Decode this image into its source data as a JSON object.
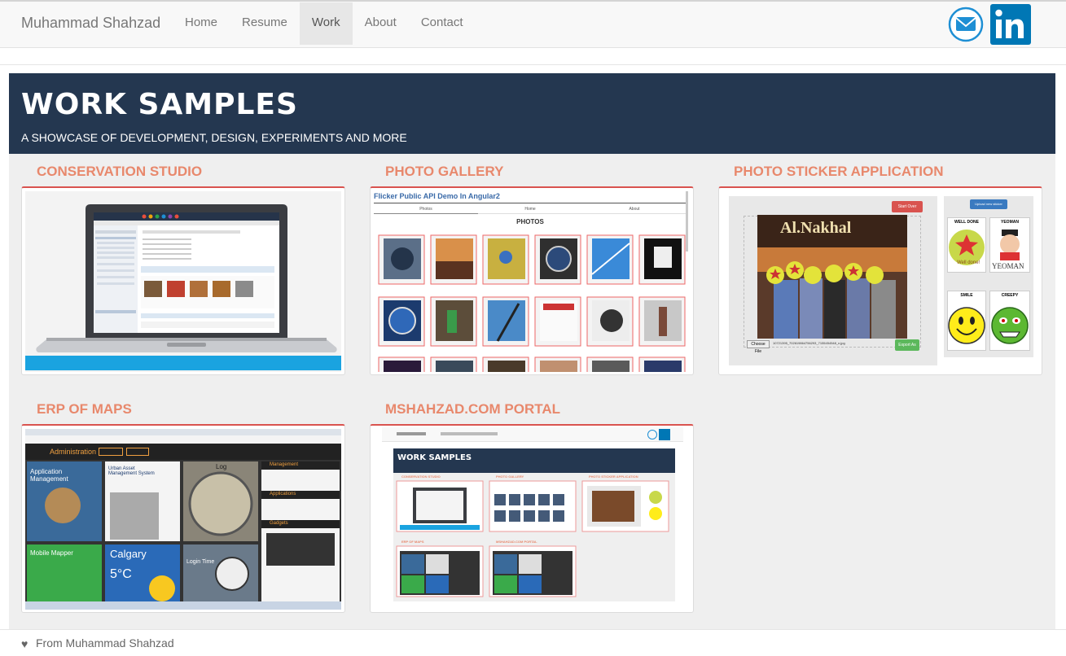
{
  "navbar": {
    "brand": "Muhammad Shahzad",
    "links": [
      {
        "label": "Home"
      },
      {
        "label": "Resume"
      },
      {
        "label": "Work",
        "active": true
      },
      {
        "label": "About"
      },
      {
        "label": "Contact"
      }
    ],
    "icons": [
      "mail-icon",
      "linkedin-icon"
    ]
  },
  "jumbotron": {
    "title": "WORK SAMPLES",
    "subtitle": "A SHOWCASE OF DEVELOPMENT, DESIGN, EXPERIMENTS AND MORE"
  },
  "cards": [
    {
      "title": "CONSERVATION STUDIO"
    },
    {
      "title": "PHOTO GALLERY"
    },
    {
      "title": "PHOTO STICKER APPLICATION"
    },
    {
      "title": "ERP OF MAPS"
    },
    {
      "title": "MSHAHZAD.COM PORTAL"
    }
  ],
  "gallery_preview": {
    "app_title": "Flicker Public API Demo In Angular2",
    "tabs": [
      "Photos",
      "Home",
      "About"
    ],
    "heading": "PHOTOS"
  },
  "sticker_preview": {
    "start_over": "Start Over",
    "upload": "Upload new sticker",
    "stickers": [
      "WELL DONE",
      "YEOMAN",
      "SMILE",
      "CREEPY"
    ],
    "photo_sign": "Al.Nakhal",
    "choose_file": "Choose File",
    "file_name": "10721395_702619864756293_7155454548_n.jpg",
    "export": "Export As",
    "sticker_texts": [
      "Well done!",
      "YEOMAN"
    ]
  },
  "erp_preview": {
    "header": "Administration",
    "tiles": [
      "Application Management",
      "Urban Asset Management System",
      "Mobile Mapper",
      "Calgary",
      "5°C",
      "Login Time",
      "Log"
    ],
    "menu": [
      "Management",
      "Applications",
      "Gadgets"
    ]
  },
  "portal_preview": {
    "title": "WORK SAMPLES",
    "labels": [
      "CONSERVATION STUDIO",
      "PHOTO GALLERY",
      "PHOTO STICKER APPLICATION",
      "ERP OF MAPS",
      "MSHAHZAD.COM PORTAL"
    ]
  },
  "footer": {
    "text": "From Muhammad Shahzad"
  },
  "colors": {
    "jumbotron_bg": "#243750",
    "card_title": "#e8886c",
    "card_accent": "#d9534f",
    "linkedin": "#0077b5"
  }
}
